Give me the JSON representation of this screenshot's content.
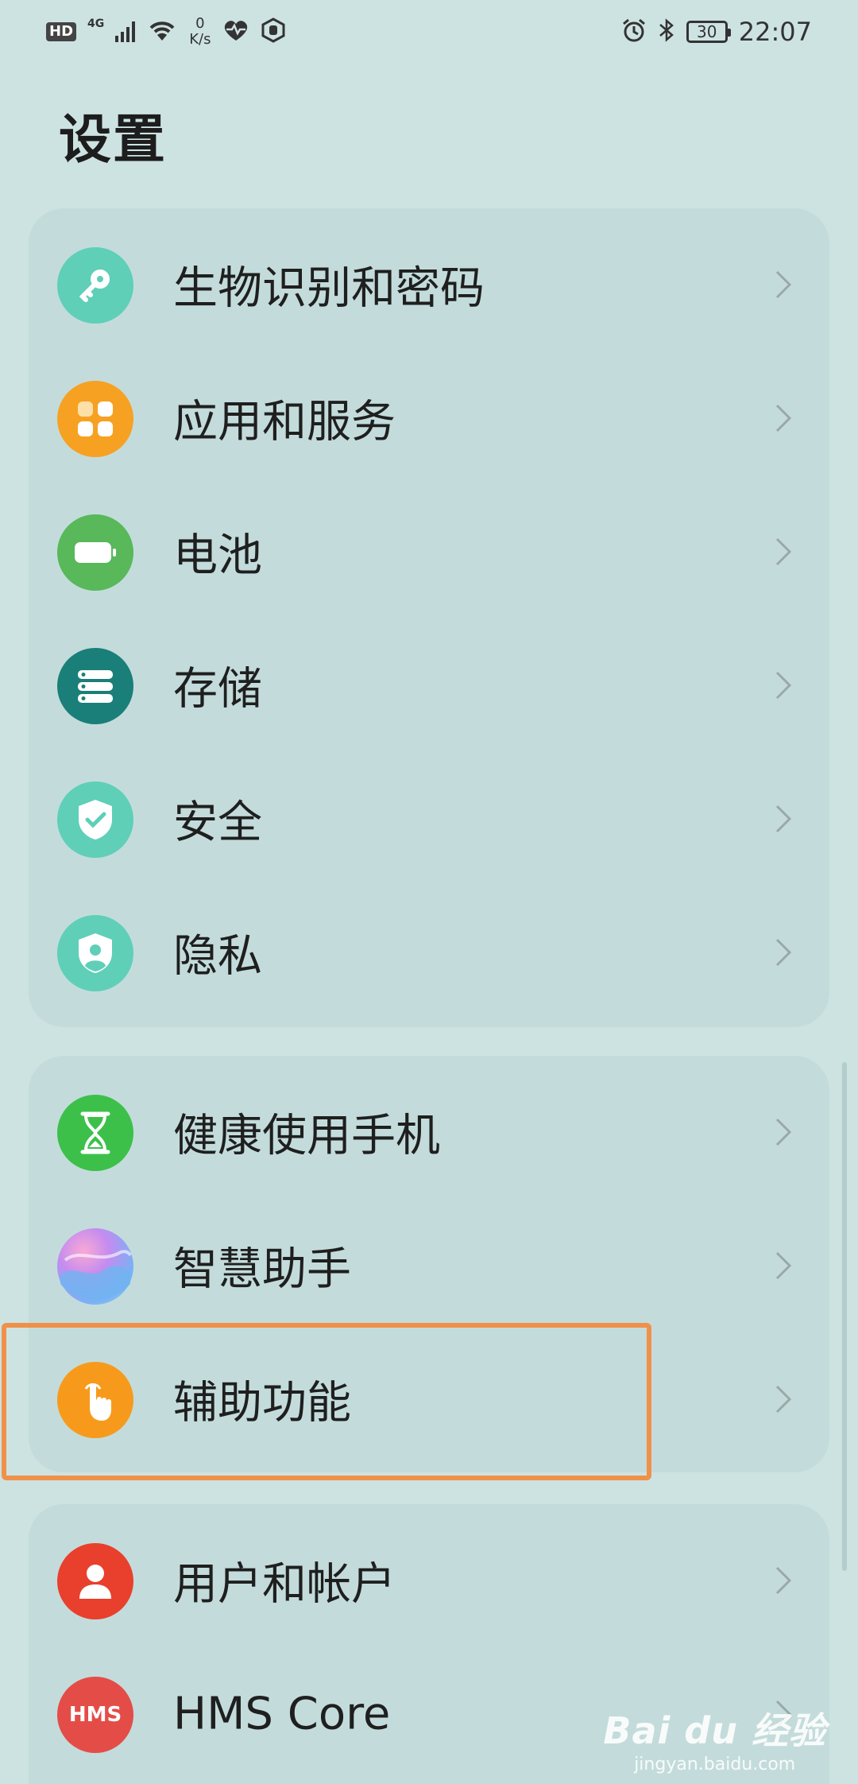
{
  "status_bar": {
    "hd": "HD",
    "network": "4G",
    "speed_value": "0",
    "speed_unit": "K/s",
    "battery_level": "30",
    "time": "22:07"
  },
  "page": {
    "title": "设置"
  },
  "groups": [
    {
      "items": [
        {
          "label": "生物识别和密码",
          "icon": "key-icon",
          "color": "#5fcfb8"
        },
        {
          "label": "应用和服务",
          "icon": "apps-grid-icon",
          "color": "#f7a123"
        },
        {
          "label": "电池",
          "icon": "battery-icon",
          "color": "#58b85a"
        },
        {
          "label": "存储",
          "icon": "storage-icon",
          "color": "#1a7f78"
        },
        {
          "label": "安全",
          "icon": "shield-check-icon",
          "color": "#5fcfb8"
        },
        {
          "label": "隐私",
          "icon": "privacy-shield-icon",
          "color": "#5fcfb8"
        }
      ]
    },
    {
      "items": [
        {
          "label": "健康使用手机",
          "icon": "hourglass-icon",
          "color": "#3cc04a"
        },
        {
          "label": "智慧助手",
          "icon": "assistant-icon",
          "color": "#9bb8f0"
        },
        {
          "label": "辅助功能",
          "icon": "touch-hand-icon",
          "color": "#f79a1c"
        }
      ]
    },
    {
      "items": [
        {
          "label": "用户和帐户",
          "icon": "user-icon",
          "color": "#e8402d"
        },
        {
          "label": "HMS Core",
          "icon": "hms-icon",
          "color": "#e44d47",
          "icon_text": "HMS"
        }
      ]
    }
  ],
  "watermark": {
    "main": "Bai du 经验",
    "sub": "jingyan.baidu.com"
  }
}
